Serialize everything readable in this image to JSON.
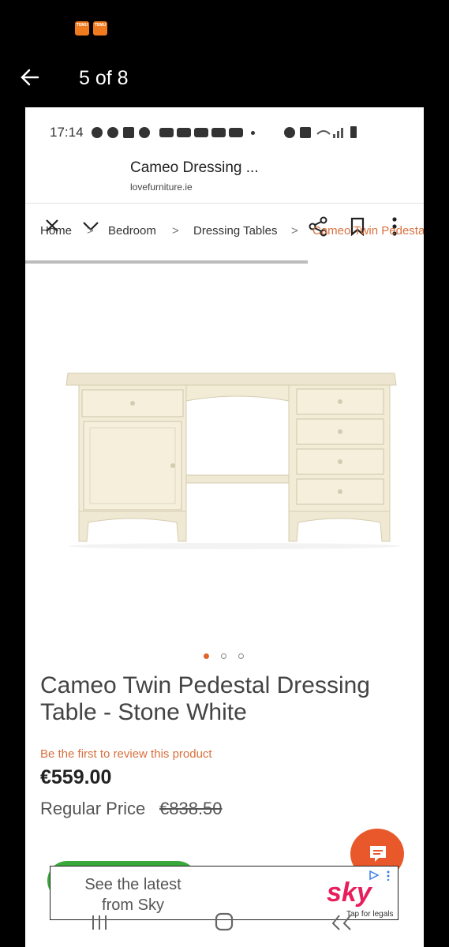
{
  "outer_status": {
    "notification_icons": [
      "temu-icon",
      "temu-icon"
    ]
  },
  "viewer": {
    "counter": "5 of 8"
  },
  "inner_status": {
    "time": "17:14"
  },
  "tab": {
    "title": "Cameo Dressing ...",
    "url": "lovefurniture.ie"
  },
  "breadcrumb": [
    "Home",
    "Bedroom",
    "Dressing Tables",
    "Cameo Twin Pedesta"
  ],
  "product": {
    "title": "Cameo Twin Pedestal Dressing Table - Stone White",
    "review_link": "Be the first to review this product",
    "price": "€559.00",
    "regular_label": "Regular Price",
    "regular_value": "€838.50",
    "image_count": 3,
    "active_image": 1
  },
  "ad": {
    "text": "See the latest from Sky",
    "brand": "sky",
    "legal": "Tap for legals"
  },
  "colors": {
    "accent": "#d9703e",
    "fab": "#e8582a",
    "sky": "#e81e5c"
  }
}
